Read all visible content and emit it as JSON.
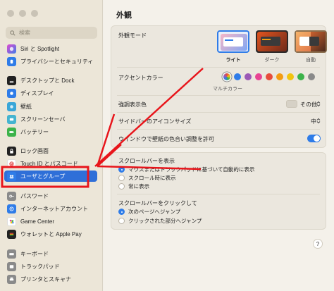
{
  "window": {
    "title": "外観"
  },
  "sidebar": {
    "search_placeholder": "検索",
    "items": [
      {
        "label": "Siri と Spotlight",
        "icon": "siri-icon",
        "color": "#8e5bd8"
      },
      {
        "label": "プライバシーとセキュリティ",
        "icon": "hand-icon",
        "color": "#2f7ce8"
      },
      {
        "label": "デスクトップと Dock",
        "icon": "dock-icon",
        "color": "#222222"
      },
      {
        "label": "ディスプレイ",
        "icon": "display-icon",
        "color": "#2f7ce8"
      },
      {
        "label": "壁紙",
        "icon": "wallpaper-icon",
        "color": "#3aa6d8"
      },
      {
        "label": "スクリーンセーバ",
        "icon": "screensaver-icon",
        "color": "#45b4d0"
      },
      {
        "label": "バッテリー",
        "icon": "battery-icon",
        "color": "#3cb34a"
      },
      {
        "label": "ロック画面",
        "icon": "lock-icon",
        "color": "#222222"
      },
      {
        "label": "Touch ID とパスコード",
        "icon": "fingerprint-icon",
        "color": "#e24a4a"
      },
      {
        "label": "ユーザとグループ",
        "icon": "users-icon",
        "color": "#2f7ce8"
      },
      {
        "label": "パスワード",
        "icon": "key-icon",
        "color": "#8a8a8a"
      },
      {
        "label": "インターネットアカウント",
        "icon": "at-icon",
        "color": "#2f7ce8"
      },
      {
        "label": "Game Center",
        "icon": "gamecenter-icon",
        "color": "#ffffff"
      },
      {
        "label": "ウォレットと Apple Pay",
        "icon": "wallet-icon",
        "color": "#222222"
      },
      {
        "label": "キーボード",
        "icon": "keyboard-icon",
        "color": "#8a8a8a"
      },
      {
        "label": "トラックパッド",
        "icon": "trackpad-icon",
        "color": "#8a8a8a"
      },
      {
        "label": "プリンタとスキャナ",
        "icon": "printer-icon",
        "color": "#8a8a8a"
      }
    ]
  },
  "appearance": {
    "label": "外観モード",
    "options": [
      {
        "label": "ライト",
        "selected": true
      },
      {
        "label": "ダーク",
        "selected": false
      },
      {
        "label": "自動",
        "selected": false
      }
    ]
  },
  "accent": {
    "label": "アクセントカラー",
    "selected_label": "マルチカラー",
    "colors": [
      "#d0d0d0",
      "#2f7ce8",
      "#9b59b6",
      "#e84393",
      "#e74c3c",
      "#f39c12",
      "#f1c40f",
      "#3cb34a",
      "#8a8a8a"
    ]
  },
  "highlight": {
    "label": "強調表示色",
    "value": "その他"
  },
  "sidebar_icon_size": {
    "label": "サイドバーのアイコンサイズ",
    "value": "中"
  },
  "tint": {
    "label": "ウインドウで壁紙の色合い調整を許可",
    "enabled": true
  },
  "scrollbars": {
    "label": "スクロールバーを表示",
    "options": [
      {
        "label": "マウスまたはトラックパッドに基づいて自動的に表示",
        "selected": true
      },
      {
        "label": "スクロール時に表示",
        "selected": false
      },
      {
        "label": "常に表示",
        "selected": false
      }
    ]
  },
  "click_scroll": {
    "label": "スクロールバーをクリックして",
    "options": [
      {
        "label": "次のページへジャンプ",
        "selected": true
      },
      {
        "label": "クリックされた部分へジャンプ",
        "selected": false
      }
    ]
  },
  "help": {
    "label": "?"
  },
  "annotation_color": "#e8151b"
}
